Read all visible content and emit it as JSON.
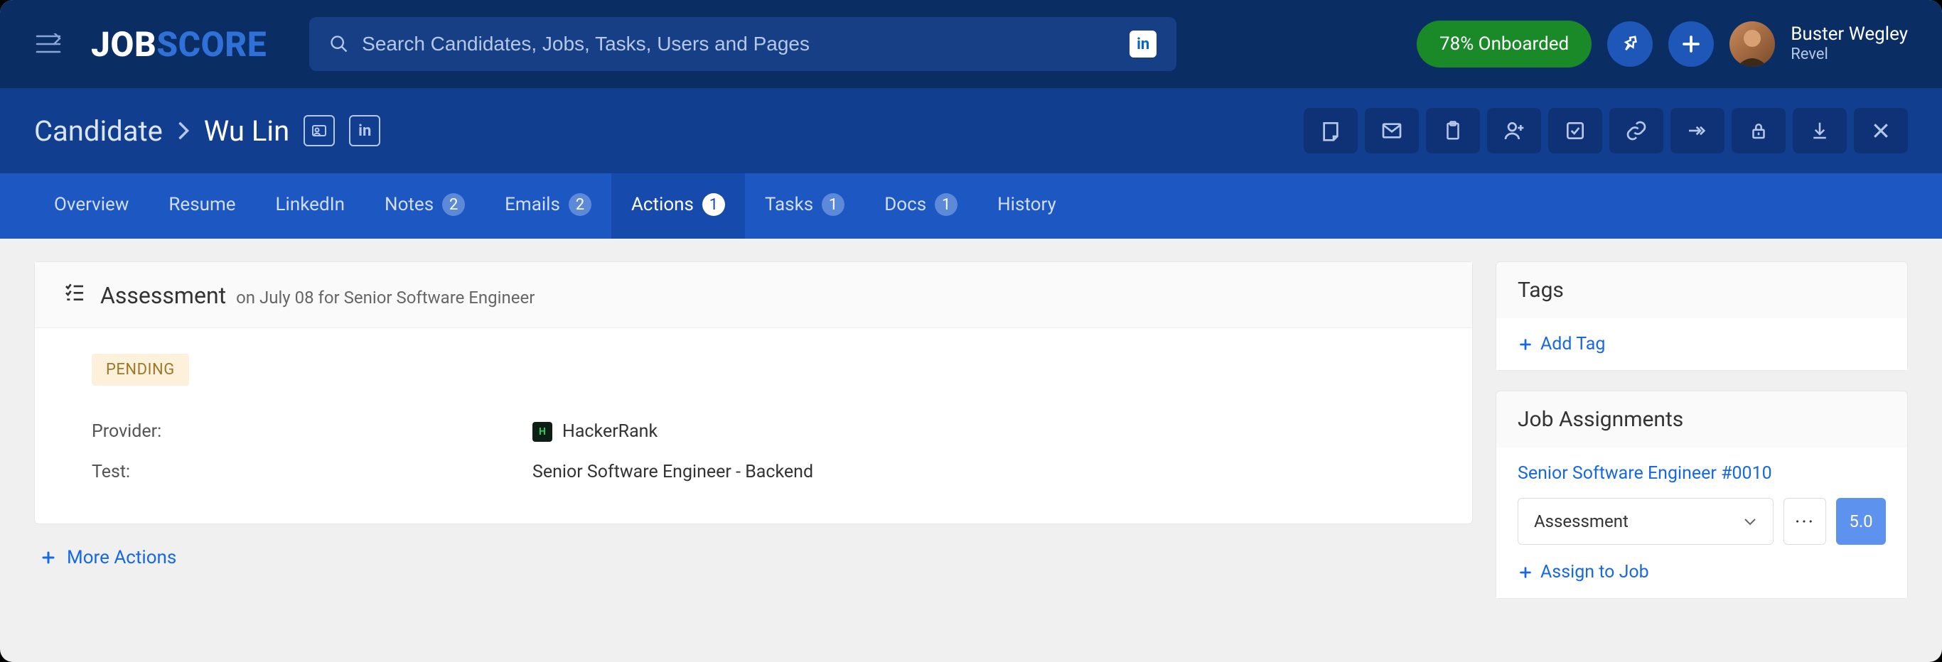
{
  "header": {
    "logo_job": "JOB",
    "logo_score": "SCORE",
    "search_placeholder": "Search Candidates, Jobs, Tasks, Users and Pages",
    "onboarded_label": "78% Onboarded",
    "user_name": "Buster Wegley",
    "user_org": "Revel"
  },
  "breadcrumb": {
    "root": "Candidate",
    "current": "Wu Lin"
  },
  "tabs": {
    "overview": "Overview",
    "resume": "Resume",
    "linkedin": "LinkedIn",
    "notes": "Notes",
    "notes_count": "2",
    "emails": "Emails",
    "emails_count": "2",
    "actions": "Actions",
    "actions_count": "1",
    "tasks": "Tasks",
    "tasks_count": "1",
    "docs": "Docs",
    "docs_count": "1",
    "history": "History"
  },
  "assessment": {
    "title": "Assessment",
    "subtitle": "on July 08 for Senior Software Engineer",
    "status": "PENDING",
    "provider_label": "Provider:",
    "provider_value": "HackerRank",
    "test_label": "Test:",
    "test_value": "Senior Software Engineer - Backend"
  },
  "more_actions_label": "More Actions",
  "sidebar": {
    "tags_title": "Tags",
    "add_tag_label": "Add Tag",
    "jobs_title": "Job Assignments",
    "job_link": "Senior Software Engineer #0010",
    "stage_value": "Assessment",
    "score_value": "5.0",
    "assign_label": "Assign to Job"
  }
}
